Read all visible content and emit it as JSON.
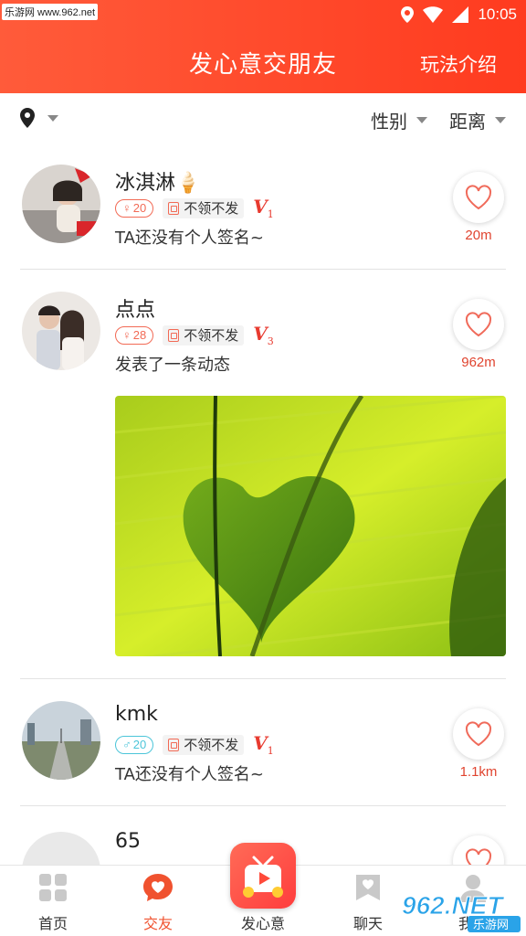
{
  "status": {
    "watermark": "乐游网 www.962.net",
    "time": "10:05"
  },
  "header": {
    "title": "发心意交朋友",
    "rules": "玩法介绍"
  },
  "filter": {
    "gender": "性别",
    "distance": "距离"
  },
  "users": [
    {
      "name": "冰淇淋🍦",
      "age": "20",
      "gender": "female",
      "label": "不领不发",
      "vip": "1",
      "signature": "TA还没有个人签名~",
      "distance": "20m"
    },
    {
      "name": "点点",
      "age": "28",
      "gender": "female",
      "label": "不领不发",
      "vip": "3",
      "signature": "发表了一条动态",
      "distance": "962m"
    },
    {
      "name": "kmk",
      "age": "20",
      "gender": "male",
      "label": "不领不发",
      "vip": "1",
      "signature": "TA还没有个人签名~",
      "distance": "1.1km"
    },
    {
      "name": "65"
    }
  ],
  "tabs": [
    {
      "label": "首页",
      "icon": "home-grid-icon"
    },
    {
      "label": "交友",
      "icon": "chat-heart-icon"
    },
    {
      "label": "发心意",
      "icon": "tv-gift-icon"
    },
    {
      "label": "聊天",
      "icon": "chat-bookmark-icon"
    },
    {
      "label": "我的",
      "icon": "user-icon"
    }
  ],
  "colors": {
    "accent": "#ff3b1f",
    "distance": "#e0442f",
    "female_tag": "#f26a55",
    "male_tag": "#4cc5d9"
  },
  "logo": "962.NET 乐游网"
}
